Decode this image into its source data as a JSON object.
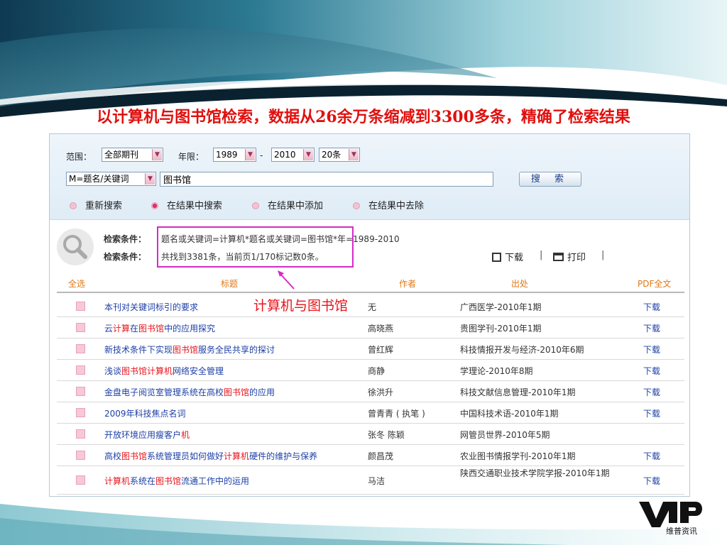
{
  "slide": {
    "title": "以计算机与图书馆检索，数据从26余万条缩减到3300多条，精确了检索结果"
  },
  "search": {
    "scope_label": "范围：",
    "scope_value": "全部期刊",
    "year_label": "年限：",
    "year_from": "1989",
    "year_dash": "-",
    "year_to": "2010",
    "page_size": "20条",
    "field_value": "M=题名/关键词",
    "keyword_value": "图书馆",
    "search_button": "搜 索",
    "options": [
      {
        "label": "重新搜索",
        "selected": false
      },
      {
        "label": "在结果中搜索",
        "selected": true
      },
      {
        "label": "在结果中添加",
        "selected": false
      },
      {
        "label": "在结果中去除",
        "selected": false
      }
    ]
  },
  "summary": {
    "condition_label_1": "检索条件：",
    "condition_value_1": "题名或关键词=计算机*题名或关键词=图书馆*年=1989-2010",
    "condition_label_2": "检索条件：",
    "condition_value_2": "共找到3381条，当前页1/170标记数0条。",
    "download_label": "下载",
    "print_label": "打印",
    "separator": "|"
  },
  "annotation": {
    "text": "计算机与图书馆"
  },
  "table": {
    "columns": [
      "全选",
      "标题",
      "作者",
      "出处",
      "PDF全文"
    ],
    "rows": [
      {
        "title": [
          {
            "t": "本刊对关键词标引的要求"
          }
        ],
        "author": "无",
        "source": "广西医学-2010年1期",
        "download": "下载"
      },
      {
        "title": [
          {
            "t": "云"
          },
          {
            "t": "计算",
            "hl": true
          },
          {
            "t": "在"
          },
          {
            "t": "图书馆",
            "hl": true
          },
          {
            "t": "中的应用探究"
          }
        ],
        "author": "高晓燕",
        "source": "贵图学刊-2010年1期",
        "download": "下载"
      },
      {
        "title": [
          {
            "t": "新技术条件下实现"
          },
          {
            "t": "图书馆",
            "hl": true
          },
          {
            "t": "服务全民共享的探讨"
          }
        ],
        "author": "曾红辉",
        "source": "科技情报开发与经济-2010年6期",
        "download": "下载"
      },
      {
        "title": [
          {
            "t": "浅谈"
          },
          {
            "t": "图书馆计算机",
            "hl": true
          },
          {
            "t": "网络安全管理"
          }
        ],
        "author": "商静",
        "source": "学理论-2010年8期",
        "download": "下载"
      },
      {
        "title": [
          {
            "t": "金盘电子阅览室管理系统在高校"
          },
          {
            "t": "图书馆",
            "hl": true
          },
          {
            "t": "的应用"
          }
        ],
        "author": "徐洪升",
        "source": "科技文献信息管理-2010年1期",
        "download": "下载"
      },
      {
        "title": [
          {
            "t": "2009年科技焦点名词"
          }
        ],
        "author": "曾青青 ( 执笔 )",
        "source": "中国科技术语-2010年1期",
        "download": "下载"
      },
      {
        "title": [
          {
            "t": "开放环境应用瘦客户"
          },
          {
            "t": "机",
            "hl": true
          }
        ],
        "author": "张冬 陈颖",
        "source": "网管员世界-2010年5期",
        "download": ""
      },
      {
        "title": [
          {
            "t": "高校"
          },
          {
            "t": "图书馆",
            "hl": true
          },
          {
            "t": "系统管理员如何做好"
          },
          {
            "t": "计算机",
            "hl": true
          },
          {
            "t": "硬件的维护与保养"
          }
        ],
        "author": "颜昌茂",
        "source": "农业图书情报学刊-2010年1期",
        "download": "下载"
      },
      {
        "title": [
          {
            "t": "计算机",
            "hl": true
          },
          {
            "t": "系统在"
          },
          {
            "t": "图书馆",
            "hl": true
          },
          {
            "t": "流通工作中的运用"
          }
        ],
        "author": "马洁",
        "source": "陕西交通职业技术学院学报-2010年1期",
        "download": "下载"
      }
    ]
  },
  "logo": {
    "caption": "维普资讯"
  }
}
